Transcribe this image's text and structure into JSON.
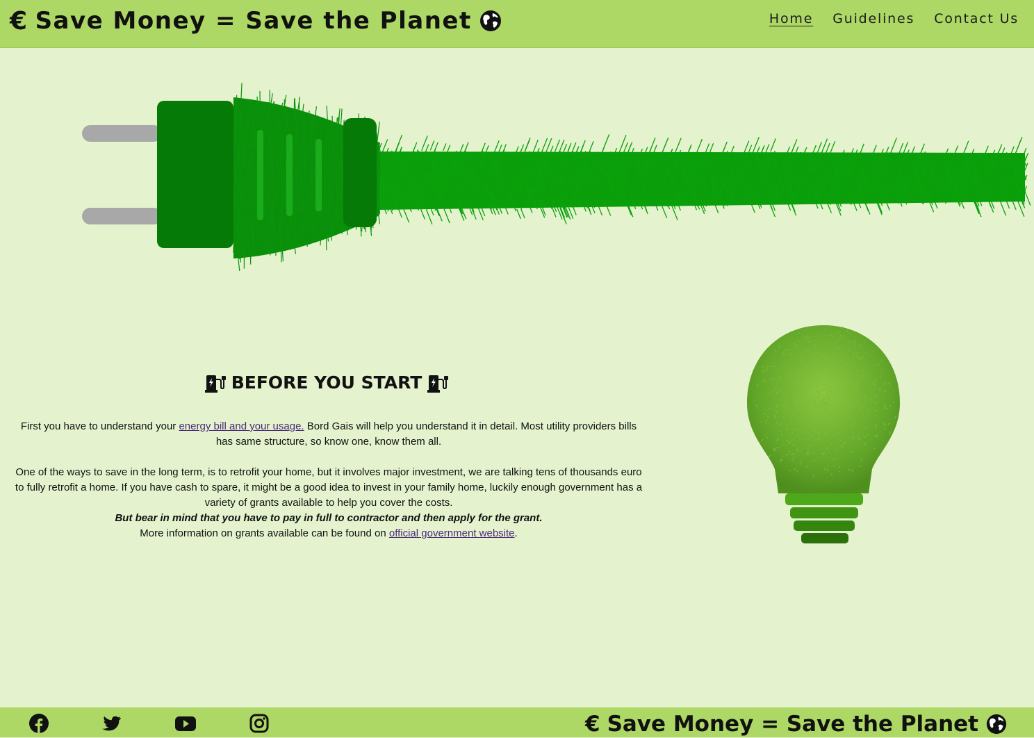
{
  "header": {
    "brand_symbol": "€",
    "brand_text": "Save Money = Save the Planet",
    "nav": [
      {
        "label": "Home",
        "active": true
      },
      {
        "label": "Guidelines",
        "active": false
      },
      {
        "label": "Contact Us",
        "active": false
      }
    ]
  },
  "hero": {
    "image": "grass-covered-power-plug"
  },
  "section": {
    "title": "BEFORE YOU START",
    "title_icon": "ev-charging-station-icon",
    "p1_before": "First you have to understand your ",
    "p1_link": "energy bill and your usage.",
    "p1_after": " Bord Gais will help you understand it in detail. Most utility providers bills has same structure, so know one, know them all.",
    "p2": "One of the ways to save in the long term, is to retrofit your home, but it involves major investment, we are talking tens of thousands euro to fully retrofit a home. If you have cash to spare, it might be a good idea to invest in your family home, luckily enough government has a variety of grants available to help you cover the costs.",
    "p3_emphasis": "But bear in mind that you have to pay in full to contractor and then apply for the grant.",
    "p4_before": "More information on grants available can be found on ",
    "p4_link": "official government website",
    "p4_after": "."
  },
  "side_image": "grass-light-bulb",
  "footer": {
    "social": [
      "facebook-icon",
      "twitter-icon",
      "youtube-icon",
      "instagram-icon"
    ],
    "brand_symbol": "€",
    "brand_text": "Save Money = Save the Planet"
  },
  "colors": {
    "page_bg": "#e4f2cd",
    "bar_bg": "#add865",
    "plug_green": "#067a06",
    "grass_green": "#0da10d",
    "link": "#4b2a7a"
  }
}
